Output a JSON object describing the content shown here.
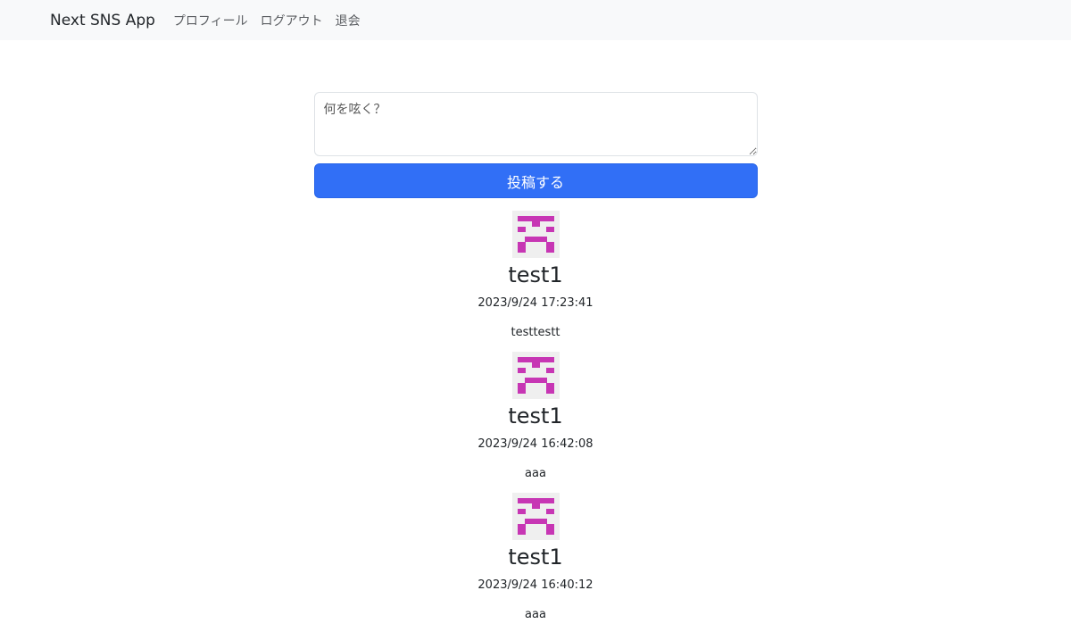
{
  "navbar": {
    "brand": "Next SNS App",
    "links": [
      {
        "label": "プロフィール"
      },
      {
        "label": "ログアウト"
      },
      {
        "label": "退会"
      }
    ]
  },
  "composer": {
    "placeholder": "何を呟く？",
    "value": "",
    "submit_label": "投稿する"
  },
  "posts": [
    {
      "username": "test1",
      "timestamp": "2023/9/24 17:23:41",
      "content": "testtestt",
      "avatar_icon": "identicon"
    },
    {
      "username": "test1",
      "timestamp": "2023/9/24 16:42:08",
      "content": "aaa",
      "avatar_icon": "identicon"
    },
    {
      "username": "test1",
      "timestamp": "2023/9/24 16:40:12",
      "content": "aaa",
      "avatar_icon": "identicon"
    }
  ],
  "colors": {
    "primary_button": "#316ff6",
    "identicon": "#c736b4",
    "navbar_bg": "#f8f9fa"
  }
}
